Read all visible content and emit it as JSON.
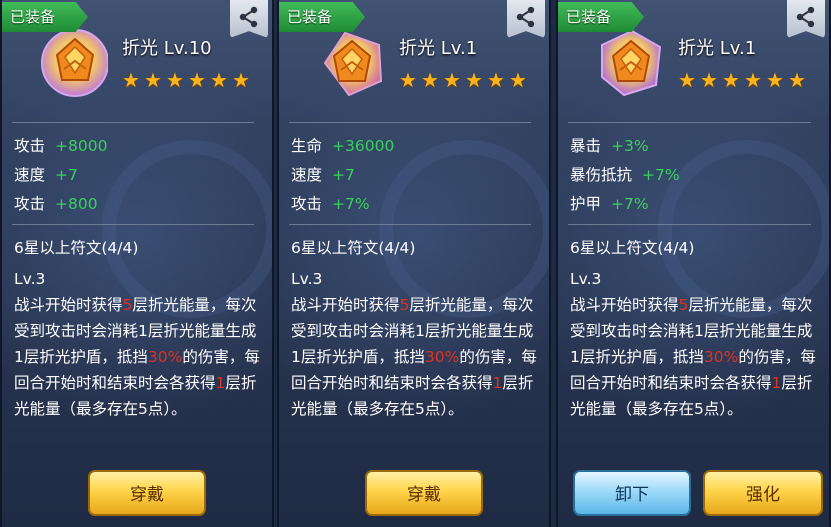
{
  "panels": [
    {
      "equipped_label": "已装备",
      "rune_name": "折光 Lv.10",
      "stars": 6,
      "stats": [
        {
          "name": "攻击",
          "value": "+8000"
        },
        {
          "name": "速度",
          "value": "+7"
        },
        {
          "name": "攻击",
          "value": "+800"
        }
      ],
      "set_title": "6星以上符文(4/4)",
      "desc_level": "Lv.3",
      "desc_parts": [
        "战斗开始时获得",
        "5",
        "层折光能量，每次受到攻击时会消耗1层折光能量生成1层折光护盾，抵挡",
        "30%",
        "的伤害，每回合开始时和结束时会各获得",
        "1",
        "层折光能量（最多存在5点）。"
      ],
      "buttons": [
        "穿戴"
      ]
    },
    {
      "equipped_label": "已装备",
      "rune_name": "折光 Lv.1",
      "stars": 6,
      "stats": [
        {
          "name": "生命",
          "value": "+36000"
        },
        {
          "name": "速度",
          "value": "+7"
        },
        {
          "name": "攻击",
          "value": "+7%"
        }
      ],
      "set_title": "6星以上符文(4/4)",
      "desc_level": "Lv.3",
      "desc_parts": [
        "战斗开始时获得",
        "5",
        "层折光能量，每次受到攻击时会消耗1层折光能量生成1层折光护盾，抵挡",
        "30%",
        "的伤害，每回合开始时和结束时会各获得",
        "1",
        "层折光能量（最多存在5点）。"
      ],
      "buttons": [
        "穿戴"
      ]
    },
    {
      "equipped_label": "已装备",
      "rune_name": "折光 Lv.1",
      "stars": 6,
      "stats": [
        {
          "name": "暴击",
          "value": "+3%"
        },
        {
          "name": "暴伤抵抗",
          "value": "+7%"
        },
        {
          "name": "护甲",
          "value": "+7%"
        }
      ],
      "set_title": "6星以上符文(4/4)",
      "desc_level": "Lv.3",
      "desc_parts": [
        "战斗开始时获得",
        "5",
        "层折光能量，每次受到攻击时会消耗1层折光能量生成1层折光护盾，抵挡",
        "30%",
        "的伤害，每回合开始时和结束时会各获得",
        "1",
        "层折光能量（最多存在5点）。"
      ],
      "buttons": [
        "卸下",
        "强化"
      ]
    }
  ],
  "colors": {
    "stat_value": "#39d15a",
    "highlight": "#e0321e",
    "star": "#ffb21a",
    "equipped_tag": "#2fa548"
  },
  "icons": {
    "share": "share-icon",
    "star": "star-icon",
    "rune": "refraction-rune-icon"
  }
}
